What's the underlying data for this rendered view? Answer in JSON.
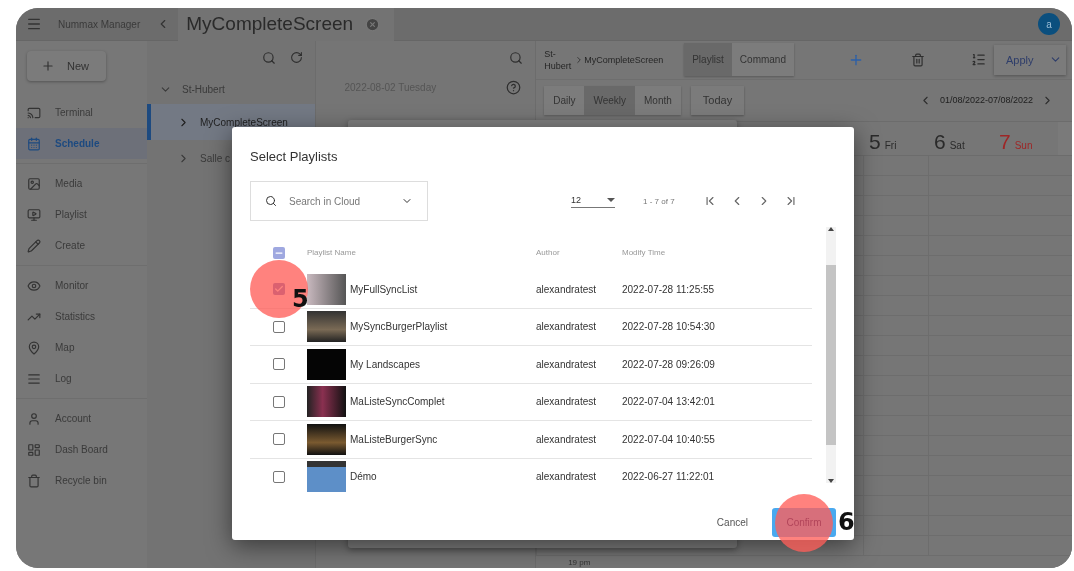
{
  "app_bar": {
    "app_name": "Nummax Manager",
    "screen_tab": "MyCompleteScreen",
    "avatar": "a"
  },
  "sidebar": {
    "new_button": "New",
    "groups": [
      {
        "items": [
          {
            "label": "Terminal",
            "selected": false
          },
          {
            "label": "Schedule",
            "selected": true
          }
        ]
      },
      {
        "items": [
          {
            "label": "Media",
            "selected": false
          },
          {
            "label": "Playlist",
            "selected": false
          },
          {
            "label": "Create",
            "selected": false
          }
        ]
      },
      {
        "items": [
          {
            "label": "Monitor",
            "selected": false
          },
          {
            "label": "Statistics",
            "selected": false
          },
          {
            "label": "Map",
            "selected": false
          },
          {
            "label": "Log",
            "selected": false
          }
        ]
      },
      {
        "items": [
          {
            "label": "Account",
            "selected": false
          },
          {
            "label": "Dash Board",
            "selected": false
          },
          {
            "label": "Recycle bin",
            "selected": false
          }
        ]
      }
    ]
  },
  "tree": {
    "items": [
      {
        "label": "St-Hubert",
        "expanded": true,
        "selected": false,
        "children": [
          {
            "label": "MyCompleteScreen",
            "expanded": false,
            "selected": true
          },
          {
            "label": "Salle c",
            "expanded": false,
            "selected": false
          }
        ]
      }
    ]
  },
  "schedule_list": {
    "date": "2022-08-02 Tuesday"
  },
  "schedule": {
    "breadcrumb": [
      "St-Hubert",
      "MyCompleteScreen"
    ],
    "tabs": [
      {
        "label": "Playlist",
        "selected": true
      },
      {
        "label": "Command",
        "selected": false
      }
    ],
    "apply_button": "Apply",
    "views": [
      {
        "label": "Daily",
        "selected": false
      },
      {
        "label": "Weekly",
        "selected": true
      },
      {
        "label": "Month",
        "selected": false
      }
    ],
    "today_button": "Today",
    "date_range": "01/08/2022-07/08/2022",
    "days": [
      {
        "number": "5",
        "name": "Fri",
        "highlighted": false
      },
      {
        "number": "6",
        "name": "Sat",
        "highlighted": false
      },
      {
        "number": "7",
        "name": "Sun",
        "highlighted": true
      }
    ],
    "time_label": "19 pm"
  },
  "dialog": {
    "title": "Select Playlists",
    "search": {
      "placeholder": "Search in Cloud"
    },
    "page_size": "12",
    "page_info": "1 - 7 of 7",
    "columns": [
      "Playlist Name",
      "Author",
      "Modify Time"
    ],
    "header_checkbox": {
      "indeterminate": true
    },
    "rows": [
      {
        "name": "MyFullSyncList",
        "author": "alexandratest",
        "modified": "2022-07-28 11:25:55",
        "checked": true,
        "step": "5"
      },
      {
        "name": "MySyncBurgerPlaylist",
        "author": "alexandratest",
        "modified": "2022-07-28 10:54:30",
        "checked": false
      },
      {
        "name": "My Landscapes",
        "author": "alexandratest",
        "modified": "2022-07-28 09:26:09",
        "checked": false
      },
      {
        "name": "MaListeSyncComplet",
        "author": "alexandratest",
        "modified": "2022-07-04 13:42:01",
        "checked": false
      },
      {
        "name": "MaListeBurgerSync",
        "author": "alexandratest",
        "modified": "2022-07-04 10:40:55",
        "checked": false
      },
      {
        "name": "Démo",
        "author": "alexandratest",
        "modified": "2022-06-27 11:22:01",
        "checked": false
      }
    ],
    "cancel_button": "Cancel",
    "confirm_button": {
      "label": "Confirm",
      "step": "6"
    }
  }
}
